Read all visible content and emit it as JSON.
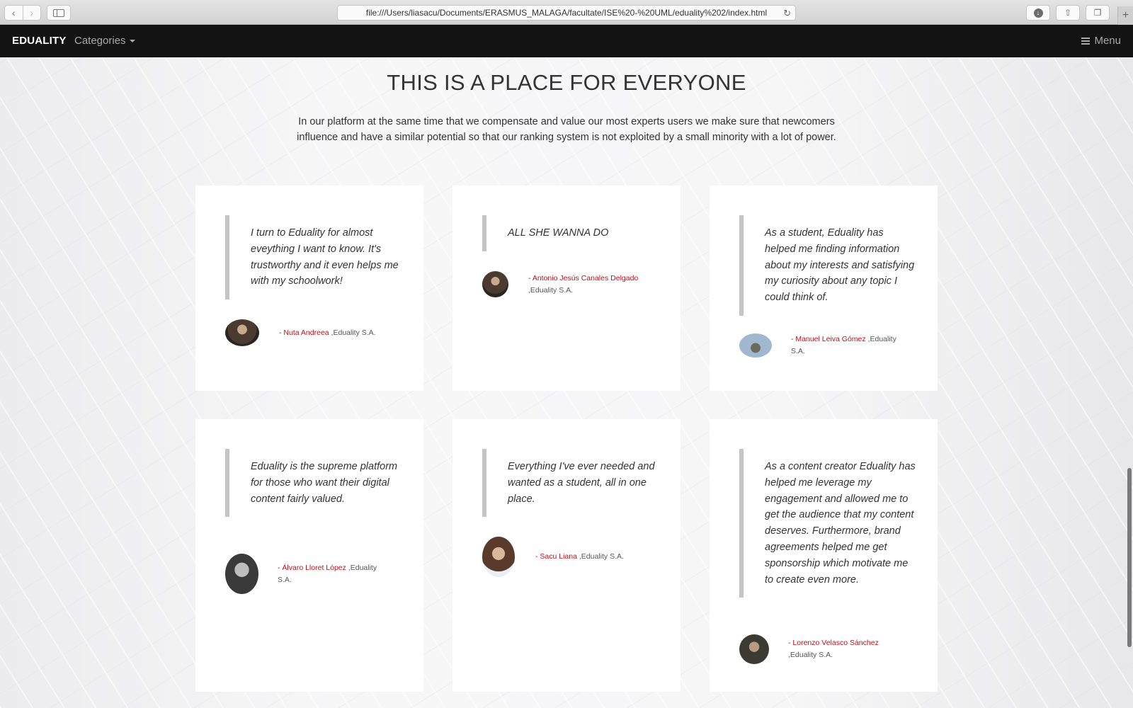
{
  "browser": {
    "url": "file:///Users/liasacu/Documents/ERASMUS_MALAGA/facultate/ISE%20-%20UML/eduality%202/index.html",
    "back_glyph": "‹",
    "forward_glyph": "›",
    "reload_glyph": "↻",
    "download_glyph": "↓",
    "share_glyph": "⇧",
    "tabs_glyph": "❐",
    "new_tab_glyph": "+"
  },
  "navbar": {
    "brand": "EDUALITY",
    "categories_label": "Categories",
    "menu_label": "Menu"
  },
  "section": {
    "title": "THIS IS A PLACE FOR EVERYONE",
    "intro": "In our platform at the same time that we compensate and value our most experts users we make sure that newcomers influence and have a similar potential so that our ranking system is not exploited by a small minority with a lot of power."
  },
  "testimonials": [
    {
      "quote": "I turn to Eduality for almost eveything I want to know. It's trustworthy and it even helps me with my schoolwork!",
      "name": "- Nuta Andreea",
      "company": " ,Eduality S.A."
    },
    {
      "quote": "ALL SHE WANNA DO",
      "name": "- Antonio Jesús Canales Delgado",
      "company": " ,Eduality S.A."
    },
    {
      "quote": "As a student, Eduality has helped me finding information about my interests and satisfying my curiosity about any topic I could think of.",
      "name": "- Manuel Leiva Gómez",
      "company": " ,Eduality S.A."
    },
    {
      "quote": "Eduality is the supreme platform for those who want their digital content fairly valued.",
      "name": "- Álvaro Lloret López",
      "company": " ,Eduality S.A."
    },
    {
      "quote": "Everything I've ever needed and wanted as a student, all in one place.",
      "name": "- Sacu Liana",
      "company": " ,Eduality S.A."
    },
    {
      "quote": "As a content creator Eduality has helped me leverage my engagement and allowed me to get the audience that my content deserves. Furthermore, brand agreements helped me get sponsorship which motivate me to create even more.",
      "name": "- Lorenzo Velasco Sánchez",
      "company": " ,Eduality S.A."
    }
  ],
  "colors": {
    "navbar_bg": "#131313",
    "author_name": "#b3141c",
    "quote_border": "#c4c4c4"
  }
}
